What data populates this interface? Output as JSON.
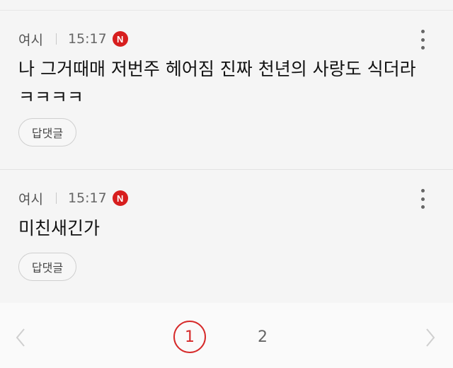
{
  "comments": [
    {
      "author": "여시",
      "time": "15:17",
      "badge": "N",
      "text": "나 그거때매 저번주 헤어짐 진짜 천년의 사랑도 식더라 ㅋㅋㅋㅋ",
      "reply_label": "답댓글"
    },
    {
      "author": "여시",
      "time": "15:17",
      "badge": "N",
      "text": "미친새긴가",
      "reply_label": "답댓글"
    }
  ],
  "pagination": {
    "pages": [
      "1",
      "2"
    ],
    "current": "1"
  },
  "colors": {
    "badge": "#d71e1e",
    "active_page": "#d62a2a"
  }
}
